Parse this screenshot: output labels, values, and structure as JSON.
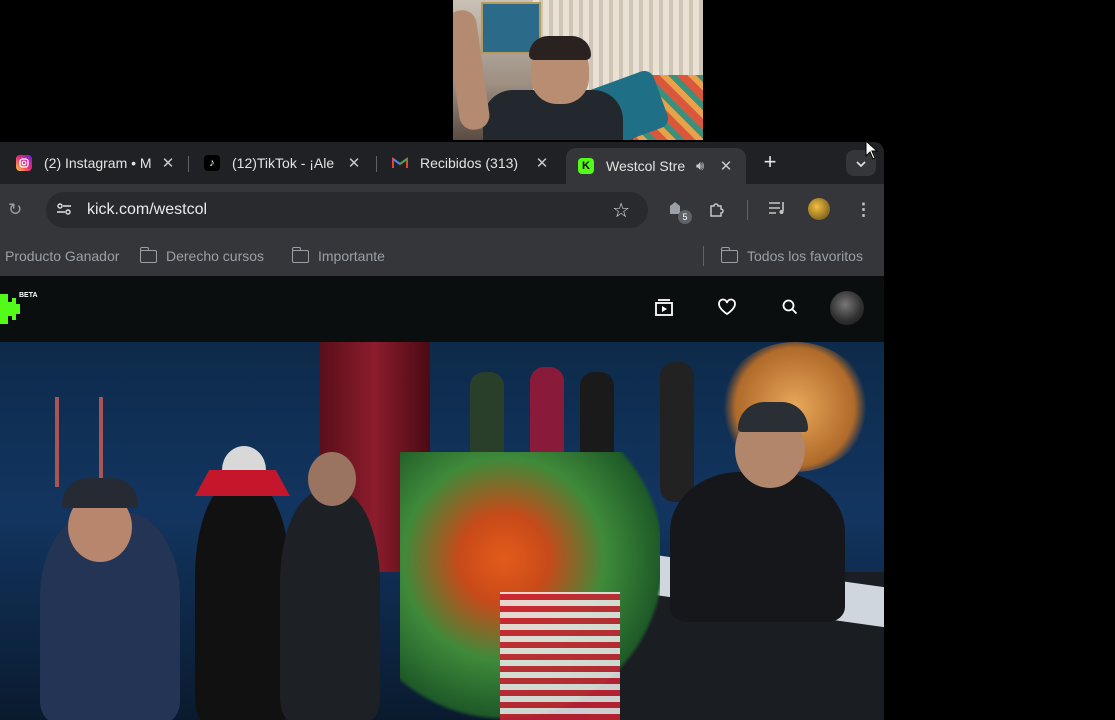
{
  "tabs": [
    {
      "title": "(2) Instagram • M",
      "icon": "instagram-icon",
      "color": "#e1306c",
      "active": false
    },
    {
      "title": "(12)TikTok - ¡Ale",
      "icon": "tiktok-icon",
      "color": "#000000",
      "active": false
    },
    {
      "title": "Recibidos (313)",
      "icon": "gmail-icon",
      "color": "#ea4335",
      "active": false
    },
    {
      "title": "Westcol Stre",
      "icon": "kick-icon",
      "color": "#53fc18",
      "active": true
    }
  ],
  "address_bar": {
    "url": "kick.com/westcol"
  },
  "extensions": {
    "badge_count": "5"
  },
  "bookmarks": {
    "items": [
      "Producto Ganador",
      "Derecho cursos",
      "Importante"
    ],
    "all_favorites": "Todos los favoritos"
  },
  "kick": {
    "logo_text": "K",
    "beta_label": "BETA",
    "brand_color": "#53fc18"
  }
}
